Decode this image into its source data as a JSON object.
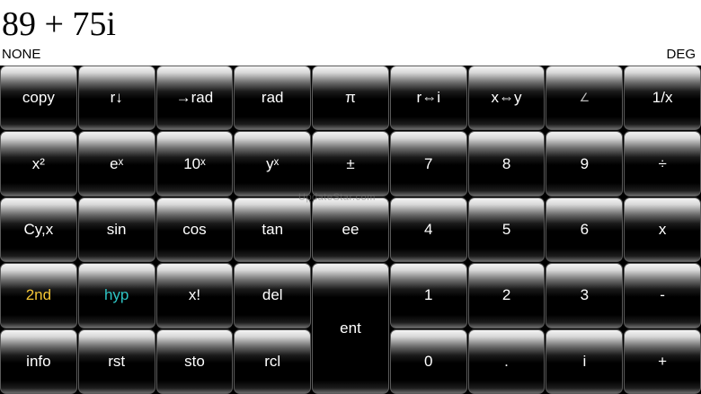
{
  "display": {
    "value": "89 + 75i"
  },
  "status": {
    "left": "NONE",
    "right": "DEG"
  },
  "watermark": "UpdateStar.com",
  "keys": {
    "copy": "copy",
    "roll_down": "r↓",
    "to_rad": "→rad",
    "rad": "rad",
    "pi": "π",
    "r_swap_i": "r⇔i",
    "x_swap_y": "x⇔y",
    "angle": "∠",
    "reciprocal": "1/x",
    "x_squared": "x²",
    "e_x": "eˣ",
    "ten_x": "10ˣ",
    "y_x": "yˣ",
    "plus_minus": "±",
    "seven": "7",
    "eight": "8",
    "nine": "9",
    "divide": "÷",
    "cyx": "Cy,x",
    "sin": "sin",
    "cos": "cos",
    "tan": "tan",
    "ee": "ee",
    "four": "4",
    "five": "5",
    "six": "6",
    "multiply": "x",
    "second": "2nd",
    "hyp": "hyp",
    "factorial": "x!",
    "del": "del",
    "ent": "ent",
    "one": "1",
    "two": "2",
    "three": "3",
    "minus": "-",
    "info": "info",
    "rst": "rst",
    "sto": "sto",
    "rcl": "rcl",
    "zero": "0",
    "dot": ".",
    "i": "i",
    "plus": "+"
  },
  "colors": {
    "second": "#f2c436",
    "hyp": "#2ec4c4",
    "key_text": "#ffffff"
  }
}
